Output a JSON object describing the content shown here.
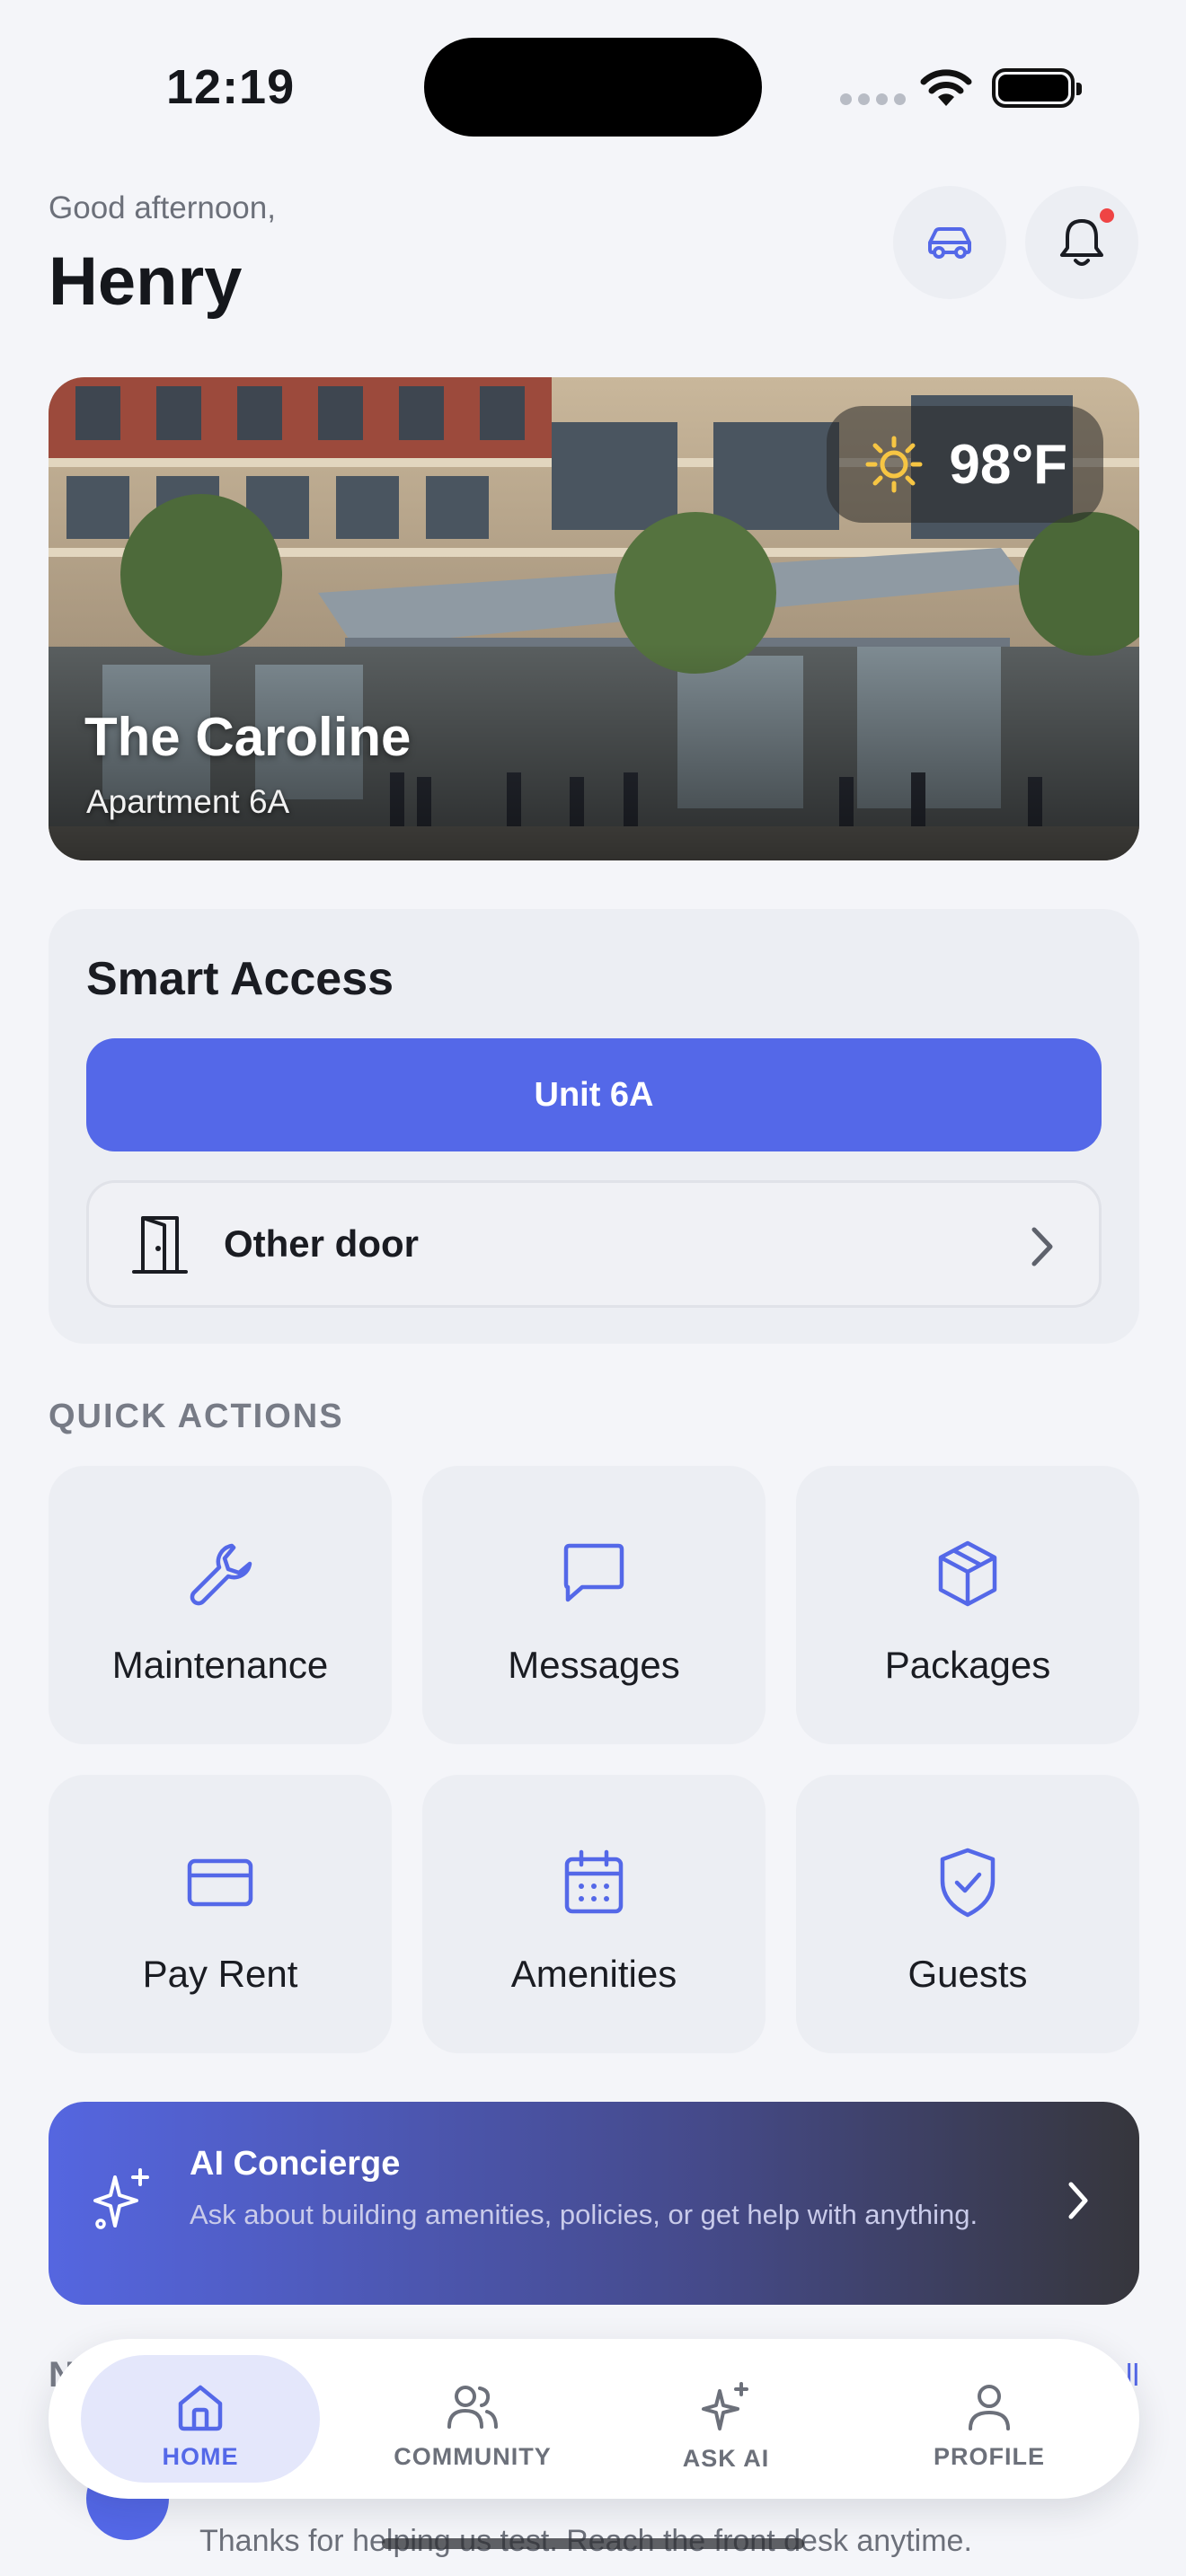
{
  "status_bar": {
    "time": "12:19"
  },
  "header": {
    "greeting": "Good afternoon,",
    "name": "Henry"
  },
  "hero": {
    "weather_temp": "98°F",
    "building_name": "The Caroline",
    "apartment": "Apartment 6A"
  },
  "smart_access": {
    "title": "Smart Access",
    "unit_button": "Unit 6A",
    "other_door_label": "Other door"
  },
  "quick_actions": {
    "heading": "QUICK ACTIONS",
    "items": [
      {
        "label": "Maintenance",
        "icon": "wrench-icon"
      },
      {
        "label": "Messages",
        "icon": "message-icon"
      },
      {
        "label": "Packages",
        "icon": "package-icon"
      },
      {
        "label": "Pay Rent",
        "icon": "credit-card-icon"
      },
      {
        "label": "Amenities",
        "icon": "calendar-icon"
      },
      {
        "label": "Guests",
        "icon": "shield-check-icon"
      }
    ]
  },
  "ai_concierge": {
    "title": "AI Concierge",
    "description": "Ask about building amenities, policies, or get help with anything."
  },
  "news_peek": {
    "heading_fragment": "N",
    "link_fragment": "ll",
    "message": "Thanks for helping us test. Reach the front desk anytime."
  },
  "tabbar": {
    "tabs": [
      {
        "label": "HOME",
        "icon": "home-icon",
        "active": true
      },
      {
        "label": "COMMUNITY",
        "icon": "users-icon",
        "active": false
      },
      {
        "label": "ASK AI",
        "icon": "sparkles-icon",
        "active": false
      },
      {
        "label": "PROFILE",
        "icon": "user-icon",
        "active": false
      }
    ]
  },
  "colors": {
    "accent": "#5468e8",
    "background": "#f4f5f9",
    "card": "#eceef3",
    "notification": "#ef4444"
  }
}
